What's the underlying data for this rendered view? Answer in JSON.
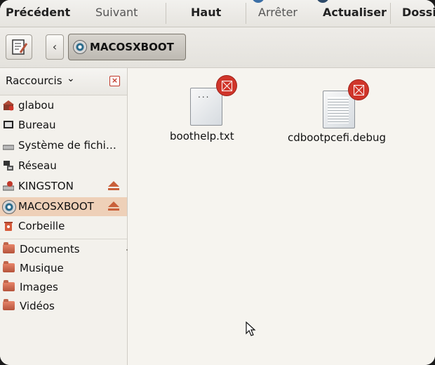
{
  "toolbar": {
    "previous_label": "Précédent",
    "next_label": "Suivant",
    "up_label": "Haut",
    "stop_label": "Arrêter",
    "reload_label": "Actualiser",
    "home_label": "Dossi"
  },
  "location": {
    "path_label": "MACOSXBOOT"
  },
  "sidebar": {
    "title": "Raccourcis",
    "items": [
      {
        "label": "glabou",
        "icon": "home-icon"
      },
      {
        "label": "Bureau",
        "icon": "desktop-icon"
      },
      {
        "label": "Système de fichi…",
        "icon": "drive-icon"
      },
      {
        "label": "Réseau",
        "icon": "network-icon"
      },
      {
        "label": "KINGSTON",
        "icon": "usb-drive-icon"
      },
      {
        "label": "MACOSXBOOT",
        "icon": "disc-icon"
      },
      {
        "label": "Corbeille",
        "icon": "trash-icon"
      },
      {
        "label": "Documents",
        "icon": "folder-icon"
      },
      {
        "label": "Musique",
        "icon": "folder-icon"
      },
      {
        "label": "Images",
        "icon": "folder-icon"
      },
      {
        "label": "Vidéos",
        "icon": "folder-icon"
      }
    ]
  },
  "files": [
    {
      "name": "boothelp.txt",
      "icon": "text-file-icon"
    },
    {
      "name": "cdbootpcefi.debug",
      "icon": "document-file-icon"
    }
  ],
  "colors": {
    "accent_selection": "#eed0b8",
    "eject": "#c9603a",
    "badge": "#d0362b"
  }
}
